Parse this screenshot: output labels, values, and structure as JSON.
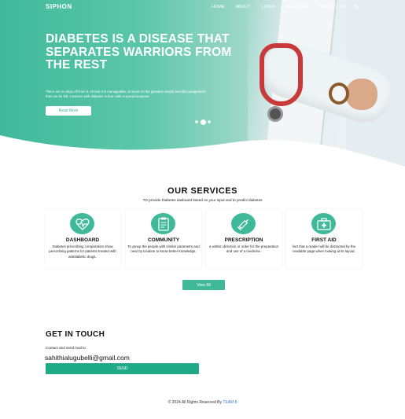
{
  "nav": {
    "brand": "SIPHON",
    "links": [
      "HOME",
      "ABOUT",
      "LOGIN",
      "REGISTER",
      "CONTACT US"
    ],
    "search_icon": "search-icon"
  },
  "hero": {
    "title": "DIABETES IS A DISEASE THAT SEPARATES WARRIORS FROM THE REST",
    "text": "There are no days off from it. At best it is manageable, at worst it's the greatest weight and discouragement that can be felt. A person with diabetes is born with a special purpose.",
    "read_more": "Read More",
    "slider_dots": 3,
    "active_dot": 2
  },
  "services": {
    "title": "OUR SERVICES",
    "subtitle": "TO provide Diabetes dasboard based on your input and to predict diabetes",
    "cards": [
      {
        "icon": "heart-pulse-icon",
        "title": "DASHBOARD",
        "desc": "Diabetes prescribing comparators show prescribing patterns for patients treated with antidiabetic drugs."
      },
      {
        "icon": "clipboard-icon",
        "title": "COMMUNITY",
        "desc": "To group the people with similar parametrs and near by location to know better knowledge."
      },
      {
        "icon": "syringe-icon",
        "title": "PRESCRIPTION",
        "desc": "a written direction or order for the preparation and use of a medicine."
      },
      {
        "icon": "first-aid-kit-icon",
        "title": "FIRST AID",
        "desc": "fact that a reader will be distracted by the readable page when looking at its layout."
      }
    ],
    "view_all": "View All"
  },
  "contact": {
    "title": "GET IN TOUCH",
    "subtitle": "Contact and send mail to",
    "email": "sahithialugubelli@gmail.com",
    "send": "SEND"
  },
  "footer": {
    "text": "© 2024 All Rights Reserved By",
    "link": "TEAM 8"
  },
  "colors": {
    "accent": "#3fb99a",
    "send_button": "#1ea987",
    "footer_link": "#3a7bd5"
  }
}
